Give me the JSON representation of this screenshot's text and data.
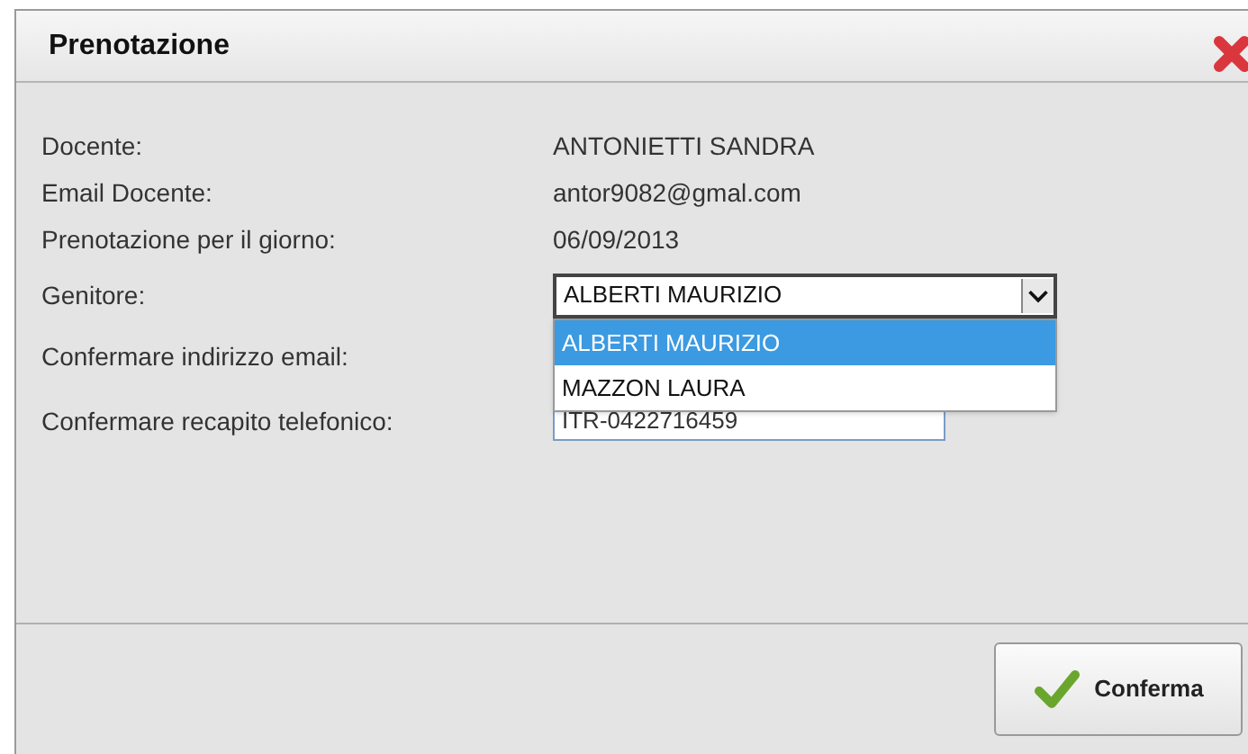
{
  "window": {
    "title": "Prenotazione"
  },
  "fields": [
    {
      "label": "Docente:",
      "value": "ANTONIETTI SANDRA"
    },
    {
      "label": "Email Docente:",
      "value": "antor9082@gmal.com"
    },
    {
      "label": "Prenotazione per il giorno:",
      "value": "06/09/2013"
    }
  ],
  "genitore": {
    "label": "Genitore:",
    "value": "ALBERTI MAURIZIO",
    "options": [
      {
        "label": "ALBERTI MAURIZIO",
        "selected": true
      },
      {
        "label": "MAZZON LAURA",
        "selected": false
      }
    ]
  },
  "email_label": "Confermare indirizzo email:",
  "phone": {
    "label": "Confermare recapito telefonico:",
    "value": "ITR-0422716459"
  },
  "buttons": [
    {
      "label": "Conferma"
    }
  ]
}
